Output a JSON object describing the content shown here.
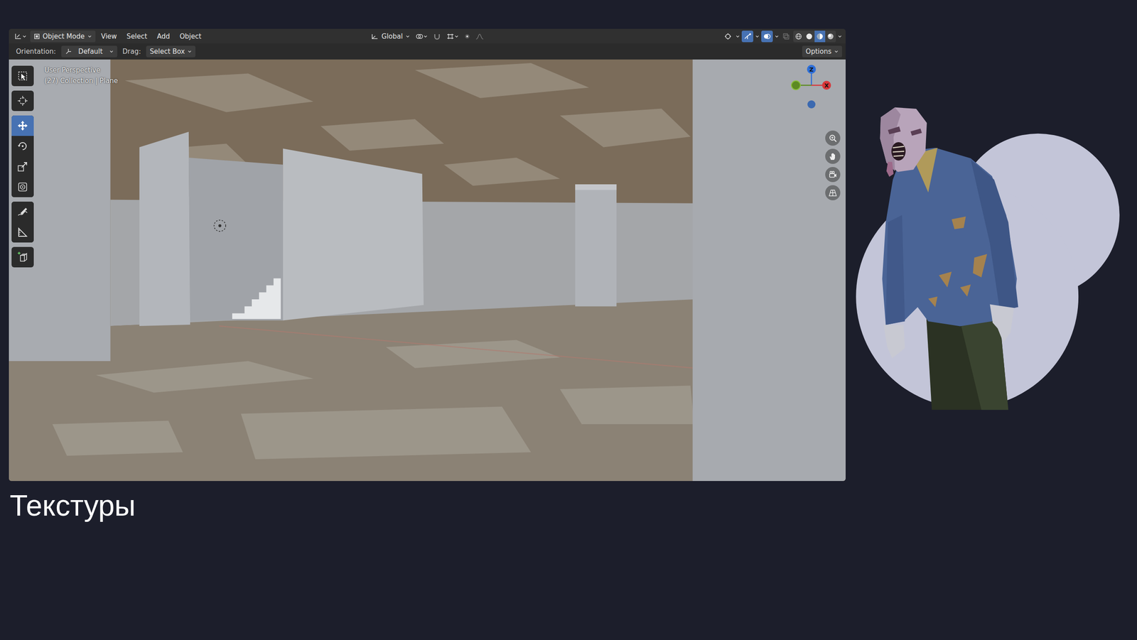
{
  "slide": {
    "caption": "Текстуры"
  },
  "header": {
    "mode": "Object Mode",
    "menus": [
      "View",
      "Select",
      "Add",
      "Object"
    ],
    "transform_orientation": "Global",
    "viewport_toggles": [
      {
        "on": false
      },
      {
        "on": true
      },
      {
        "on": true
      }
    ],
    "shading": [
      {
        "selected": false
      },
      {
        "selected": false
      },
      {
        "selected": true
      },
      {
        "selected": false
      }
    ]
  },
  "tool_header": {
    "orientation_label": "Orientation:",
    "orientation": "Default",
    "drag_label": "Drag:",
    "drag": "Select Box",
    "options": "Options"
  },
  "viewport": {
    "view_name": "User Perspective",
    "context": "(27) Collection | Plane",
    "gizmo_axes": [
      "Z",
      "X"
    ]
  },
  "toolbar": [
    {
      "selected": false
    },
    {
      "selected": false
    },
    {
      "selected": true
    },
    {
      "selected": false
    },
    {
      "selected": false
    },
    {
      "selected": false
    },
    {
      "selected": false
    },
    {
      "selected": false
    },
    {
      "selected": false
    }
  ]
}
